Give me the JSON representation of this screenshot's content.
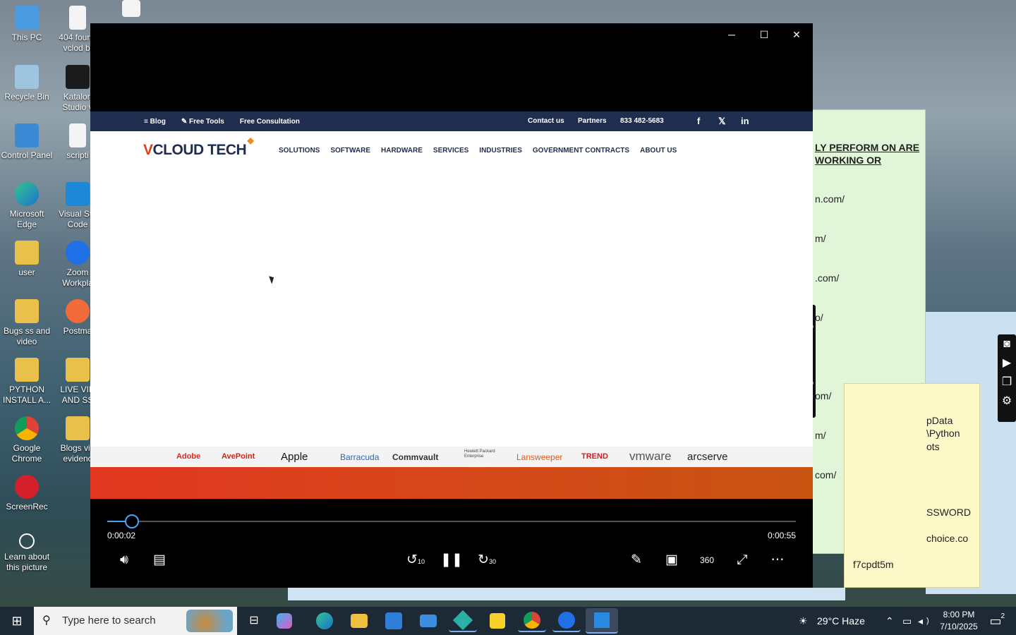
{
  "desktop": {
    "icons": [
      {
        "label": "This PC"
      },
      {
        "label": "404 found vclod bl"
      },
      {
        "label": "Recycle Bin"
      },
      {
        "label": "Katalon Studio v"
      },
      {
        "label": "Control Panel"
      },
      {
        "label": "scripti"
      },
      {
        "label": "Microsoft Edge"
      },
      {
        "label": "Visual Stu Code"
      },
      {
        "label": "user"
      },
      {
        "label": "Zoom Workpla"
      },
      {
        "label": "Bugs ss and video"
      },
      {
        "label": "Postma"
      },
      {
        "label": "PYTHON INSTALL A..."
      },
      {
        "label": "LIVE VID AND SS"
      },
      {
        "label": "Google Chrome"
      },
      {
        "label": "Blogs vid evidenc"
      },
      {
        "label": "ScreenRec"
      },
      {
        "label": "Learn about this picture"
      }
    ]
  },
  "green_note": {
    "heading": "LY PERFORM ON ARE WORKING OR",
    "lines": [
      "n.com/",
      "m/",
      ".com/",
      "o/",
      "om/",
      "m/",
      "com/"
    ]
  },
  "yellow_note": {
    "lines": [
      "pData",
      "\\Python",
      "ots",
      "SSWORD",
      "choice.co"
    ],
    "bottom": "f7cpdt5m"
  },
  "player": {
    "window_controls": {
      "minimize": "─",
      "maximize": "☐",
      "close": "✕"
    },
    "site": {
      "topbar_left": [
        "Blog",
        "Free Tools",
        "Free Consultation"
      ],
      "topbar_right": [
        "Contact us",
        "Partners",
        "833 482-5683"
      ],
      "social": [
        "f",
        "𝕏",
        "in"
      ],
      "logo_v": "V",
      "logo_rest": "CLOUD TECH",
      "nav": [
        "SOLUTIONS",
        "SOFTWARE",
        "HARDWARE",
        "SERVICES",
        "INDUSTRIES",
        "GOVERNMENT CONTRACTS",
        "ABOUT US"
      ],
      "brands": [
        "Adobe",
        "AvePoint",
        "Apple",
        "Barracuda",
        "Commvault",
        "Hewlett Packard Enterprise",
        "Lansweeper",
        "TREND",
        "vmware",
        "arcserve"
      ]
    },
    "current_time": "0:00:02",
    "total_time": "0:00:55",
    "progress": 0.036
  },
  "taskbar": {
    "search_placeholder": "Type here to search",
    "weather": "29°C  Haze",
    "time": "8:00 PM",
    "date": "7/10/2025",
    "notifications": "2"
  }
}
